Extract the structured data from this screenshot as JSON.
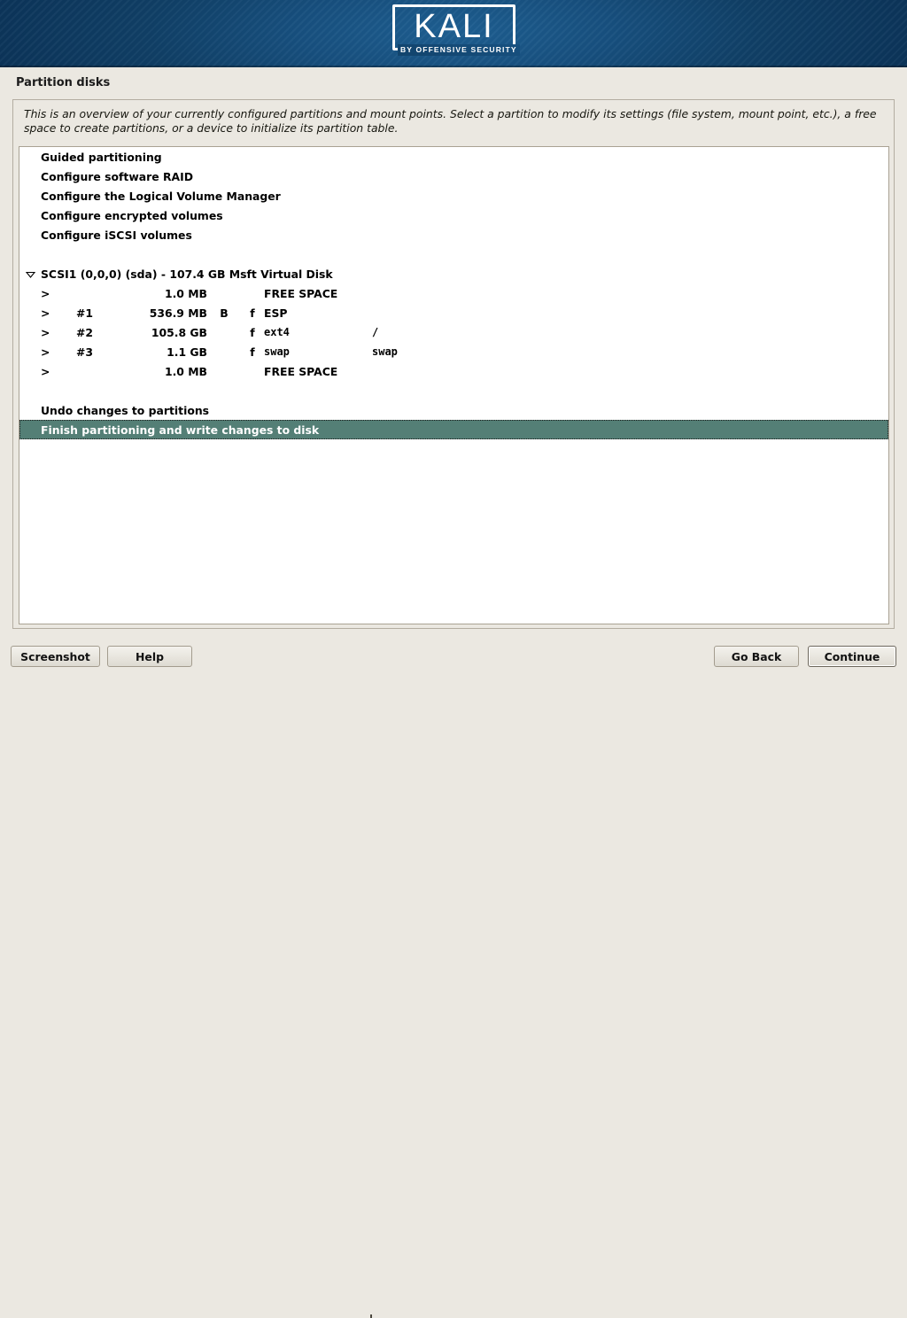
{
  "branding": {
    "logo_text": "KALI",
    "logo_tagline": "BY OFFENSIVE SECURITY"
  },
  "header": {
    "title": "Partition disks"
  },
  "main": {
    "description": "This is an overview of your currently configured partitions and mount points. Select a partition to modify its settings (file system, mount point, etc.), a free space to create partitions, or a device to initialize its partition table."
  },
  "list": {
    "menu_items": [
      {
        "label": "Guided partitioning"
      },
      {
        "label": "Configure software RAID"
      },
      {
        "label": "Configure the Logical Volume Manager"
      },
      {
        "label": "Configure encrypted volumes"
      },
      {
        "label": "Configure iSCSI volumes"
      }
    ],
    "device": {
      "expander_icon": "triangle-down-icon",
      "label": "SCSI1 (0,0,0) (sda) - 107.4 GB Msft Virtual Disk"
    },
    "partitions": [
      {
        "arrow": ">",
        "number": "",
        "size": "1.0 MB",
        "boot": "",
        "flag": "",
        "type": "FREE SPACE",
        "mount": "",
        "mono": false
      },
      {
        "arrow": ">",
        "number": "#1",
        "size": "536.9 MB",
        "boot": "B",
        "flag": "f",
        "type": "ESP",
        "mount": "",
        "mono": false
      },
      {
        "arrow": ">",
        "number": "#2",
        "size": "105.8 GB",
        "boot": "",
        "flag": "f",
        "type": "ext4",
        "mount": "/",
        "mono": true
      },
      {
        "arrow": ">",
        "number": "#3",
        "size": "1.1 GB",
        "boot": "",
        "flag": "f",
        "type": "swap",
        "mount": "swap",
        "mono": true
      },
      {
        "arrow": ">",
        "number": "",
        "size": "1.0 MB",
        "boot": "",
        "flag": "",
        "type": "FREE SPACE",
        "mount": "",
        "mono": false
      }
    ],
    "actions": [
      {
        "label": "Undo changes to partitions",
        "selected": false
      },
      {
        "label": "Finish partitioning and write changes to disk",
        "selected": true
      }
    ]
  },
  "footer": {
    "screenshot_label": "Screenshot",
    "help_label": "Help",
    "go_back_label": "Go Back",
    "continue_label": "Continue"
  },
  "colors": {
    "banner_dark": "#0b3358",
    "banner_light": "#1e5f92",
    "selection": "#547f76",
    "panel_bg": "#ebe8e1",
    "list_bg": "#ffffff"
  }
}
